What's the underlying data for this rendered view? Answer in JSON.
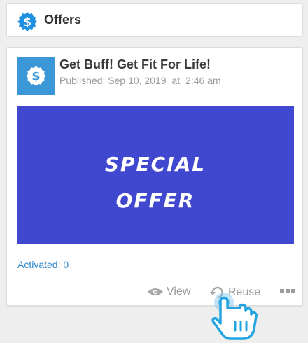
{
  "header": {
    "title": "Offers",
    "icon": "dollar-badge-icon",
    "icon_color": "#1f8fe0"
  },
  "offer": {
    "title": "Get Buff! Get Fit For Life!",
    "published_label": "Published:",
    "published_date": "Sep 10, 2019",
    "published_at": "at",
    "published_time": "2:46 am",
    "thumbnail_icon": "dollar-badge-icon",
    "thumbnail_color": "#3b97d8",
    "banner": {
      "line1": "SPECIAL",
      "line2": "OFFER",
      "background": "#4048cf"
    },
    "activated": "Activated: 0"
  },
  "actions": {
    "view_label": "View",
    "reuse_label": "Reuse",
    "more_icon": "more-dots-icon"
  },
  "cursor": "pointer-hand-icon"
}
